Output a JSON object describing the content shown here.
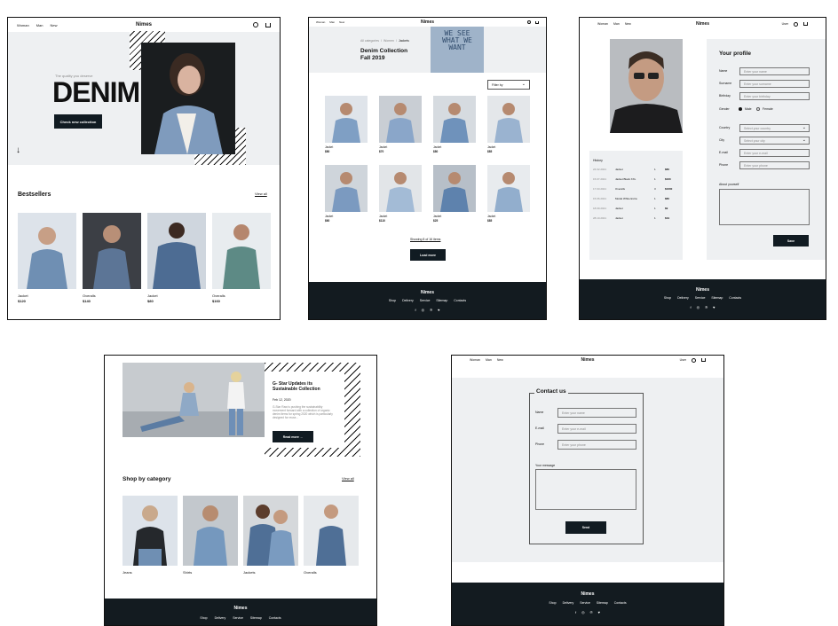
{
  "brand": "Nimes",
  "nav": {
    "women": "Woman",
    "men": "Man",
    "new": "New",
    "user": "User"
  },
  "home": {
    "tagline": "The quality you deserve",
    "hero_title": "DENIM",
    "hero_button": "Check new collection",
    "arrow": "↓",
    "bestsellers_title": "Bestsellers",
    "view_all": "View all",
    "products": [
      {
        "name": "Jacket",
        "price": "$120"
      },
      {
        "name": "Overalls",
        "price": "$140"
      },
      {
        "name": "Jacket",
        "price": "$80"
      },
      {
        "name": "Overalls",
        "price": "$160"
      }
    ]
  },
  "catalog": {
    "breadcrumb": [
      "All categories",
      "Women",
      "Jackets"
    ],
    "title_line1": "Denim Collection",
    "title_line2": "Fall 2019",
    "sign_text": "WE SEE WHAT WE WANT",
    "filter": "Filter by",
    "items": [
      {
        "name": "Jacket",
        "price": "$80"
      },
      {
        "name": "Jacket",
        "price": "$70"
      },
      {
        "name": "Jacket",
        "price": "$80"
      },
      {
        "name": "Jacket",
        "price": "$85"
      },
      {
        "name": "Jacket",
        "price": "$60"
      },
      {
        "name": "Jacket",
        "price": "$110"
      },
      {
        "name": "Jacket",
        "price": "$25"
      },
      {
        "name": "Jacket",
        "price": "$85"
      }
    ],
    "showing": "Showing 8 of 16 items",
    "load_more": "Load more"
  },
  "profile": {
    "title": "Your profile",
    "fields": [
      {
        "label": "Name",
        "placeholder": "Enter your name"
      },
      {
        "label": "Surname",
        "placeholder": "Enter your surname"
      },
      {
        "label": "Birthday",
        "placeholder": "Enter your birthday"
      }
    ],
    "gender_label": "Gender",
    "gender_male": "Male",
    "gender_female": "Female",
    "fields2": [
      {
        "label": "Country",
        "placeholder": "Select your country"
      },
      {
        "label": "City",
        "placeholder": "Select your city"
      },
      {
        "label": "E-mail",
        "placeholder": "Enter your e-mail"
      },
      {
        "label": "Phone",
        "placeholder": "Enter your phone"
      }
    ],
    "about_label": "About yourself",
    "save": "Save",
    "history_title": "History",
    "history": [
      {
        "date": "24.02.2021",
        "item": "Jacket",
        "qty": "1",
        "price": "$80"
      },
      {
        "date": "15.07.2021",
        "item": "Jacket Black XXL",
        "qty": "1",
        "price": "$160"
      },
      {
        "date": "17.03.2021",
        "item": "Overalls",
        "qty": "3",
        "price": "$1600"
      },
      {
        "date": "15.06.2021",
        "item": "Model White Extra",
        "qty": "1",
        "price": "$80"
      },
      {
        "date": "18.09.2021",
        "item": "Jacket",
        "qty": "1",
        "price": "$9"
      },
      {
        "date": "28.10.2021",
        "item": "Jacket",
        "qty": "1",
        "price": "$19"
      }
    ]
  },
  "blog": {
    "title": "G- Star Updates its Sustainable Collection",
    "date": "Feb 12, 2020",
    "text": "G-Star Raw is pushing the sustainability movement forward with a collection of organic denim items for spring 2020 which is particularly designed for reuse...",
    "read_more": "Read more →",
    "category_title": "Shop by category",
    "view_all": "View all",
    "categories": [
      "Jeans",
      "Shirts",
      "Jackets",
      "Overalls"
    ]
  },
  "contact": {
    "title": "Contact us",
    "fields": [
      {
        "label": "Name",
        "placeholder": "Enter your name"
      },
      {
        "label": "E-mail",
        "placeholder": "Enter your e-mail"
      },
      {
        "label": "Phone",
        "placeholder": "Enter your phone"
      }
    ],
    "message_label": "Your message",
    "send": "Send"
  },
  "footer": {
    "links": [
      "Shop",
      "Delivery",
      "Service",
      "Sitemap",
      "Contacts"
    ],
    "social": [
      "f",
      "◎",
      "℗",
      "♥"
    ]
  },
  "colors": {
    "dark": "#131b20",
    "light": "#eef0f2",
    "denim": "#6b88a8"
  }
}
